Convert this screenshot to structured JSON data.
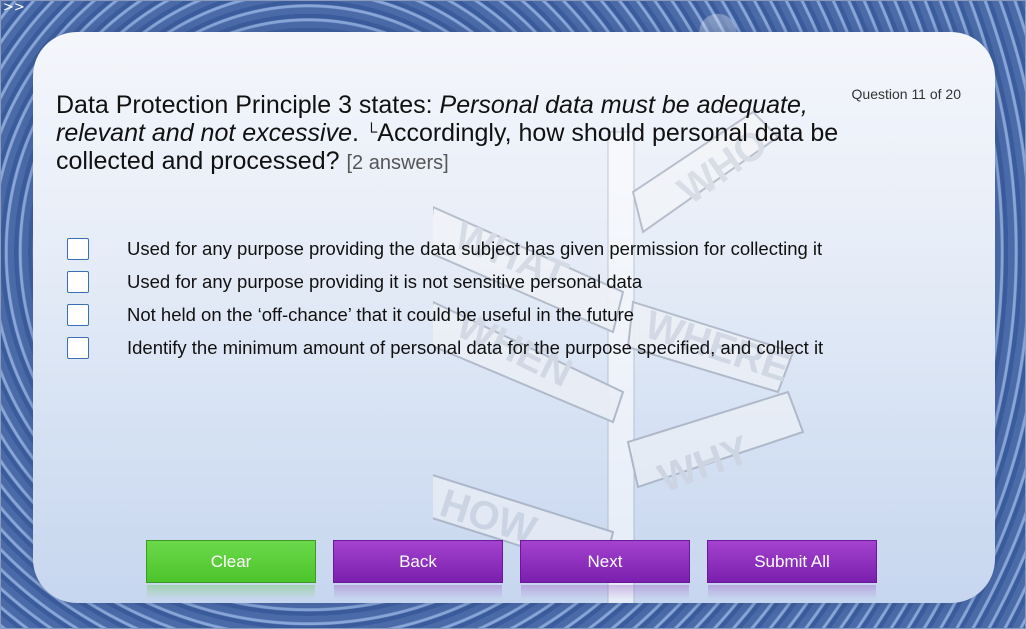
{
  "nav": {
    "expand_icon": ">>"
  },
  "quiz": {
    "counter": "Question 11 of 20",
    "question_prefix": "Data Protection Principle 3 states: ",
    "question_italic": "Personal data must be adequate, relevant and not excessive",
    "question_mid": ". ",
    "question_marker": "└",
    "question_suffix": "Accordingly, how should personal data be collected and processed? ",
    "answers_hint": "[2 answers]",
    "options": [
      {
        "label": "Used for any purpose providing the data subject has given permission for collecting it",
        "checked": false
      },
      {
        "label": "Used for any purpose providing it is not sensitive personal data",
        "checked": false
      },
      {
        "label": "Not held on the ‘off-chance’ that it could be useful in the future",
        "checked": false
      },
      {
        "label": "Identify the minimum amount of personal data for the purpose specified, and collect it",
        "checked": false
      }
    ]
  },
  "buttons": {
    "clear": "Clear",
    "back": "Back",
    "next": "Next",
    "submit": "Submit All"
  },
  "signpost": {
    "labels": [
      "WHO",
      "WHAT",
      "WHERE",
      "WHEN",
      "WHY",
      "HOW"
    ]
  },
  "colors": {
    "clear": "#5ccf3a",
    "nav_buttons": "#8e2fc0",
    "checkbox_border": "#3a6fb5"
  }
}
